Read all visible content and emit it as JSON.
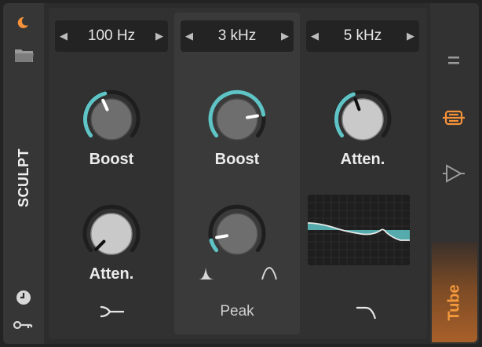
{
  "device": {
    "name": "SCULPT",
    "mode": "Tube",
    "colors": {
      "accent": "#5fc4c6",
      "orange": "#f5923a"
    }
  },
  "bands": [
    {
      "frequency": "100 Hz",
      "upper_knob": "Boost",
      "lower_knob": "Atten.",
      "upper_level": 0.3,
      "lower_level": 0.12
    },
    {
      "frequency": "3 kHz",
      "upper_knob": "Boost",
      "lower_knob": "",
      "upper_level": 0.72,
      "lower_level": 0.2,
      "footer": "Peak"
    },
    {
      "frequency": "5 kHz",
      "upper_knob": "Atten.",
      "lower_knob": "",
      "upper_level": 0.28
    }
  ],
  "icons": {
    "left": [
      "moon-icon",
      "folder-icon",
      "clock-icon",
      "key-icon"
    ],
    "right": [
      "menu-icon",
      "tube-mode-icon",
      "amp-mode-icon"
    ]
  }
}
